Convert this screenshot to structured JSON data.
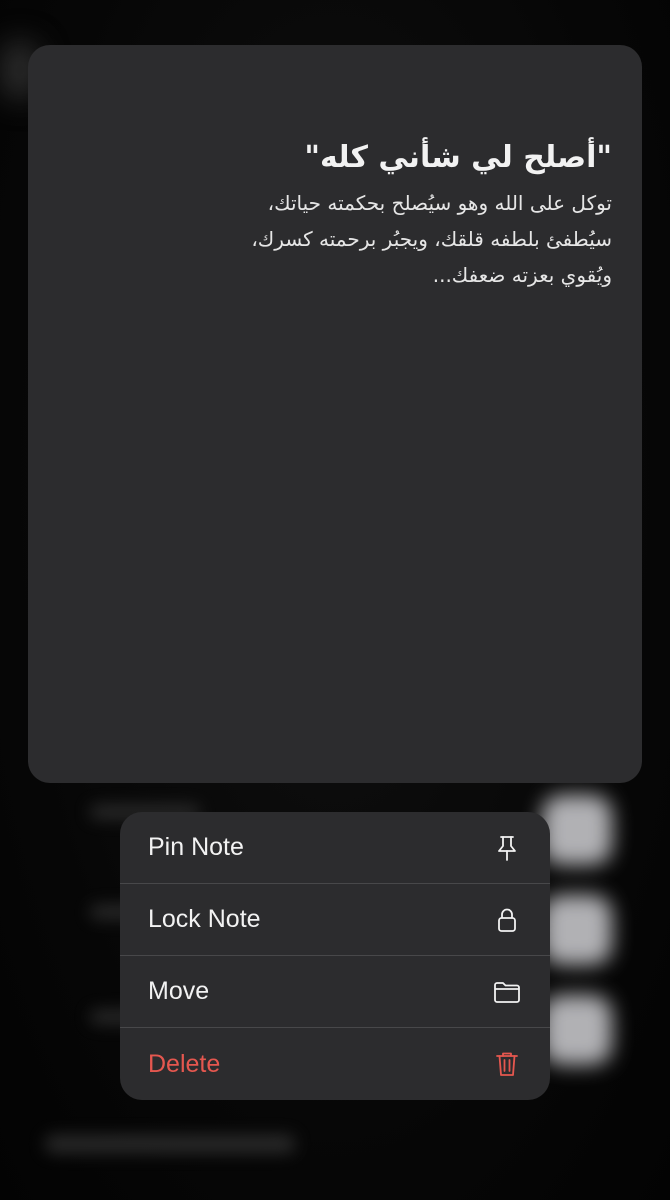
{
  "note": {
    "title": "\"أصلح لي شأني كله\"",
    "body": "توكل على الله وهو سيُصلح بحكمته حياتك، سيُطفئ بلطفه قلقك، ويجبُر برحمته كسرك، ويُقوي بعزته ضعفك..."
  },
  "menu": {
    "items": [
      {
        "label": "Pin Note",
        "icon": "pin-icon"
      },
      {
        "label": "Lock Note",
        "icon": "lock-icon"
      },
      {
        "label": "Move",
        "icon": "folder-icon"
      },
      {
        "label": "Delete",
        "icon": "trash-icon"
      }
    ]
  },
  "colors": {
    "card_bg": "#2c2c2e",
    "destructive": "#e5574f",
    "text": "#f2f2f2"
  }
}
